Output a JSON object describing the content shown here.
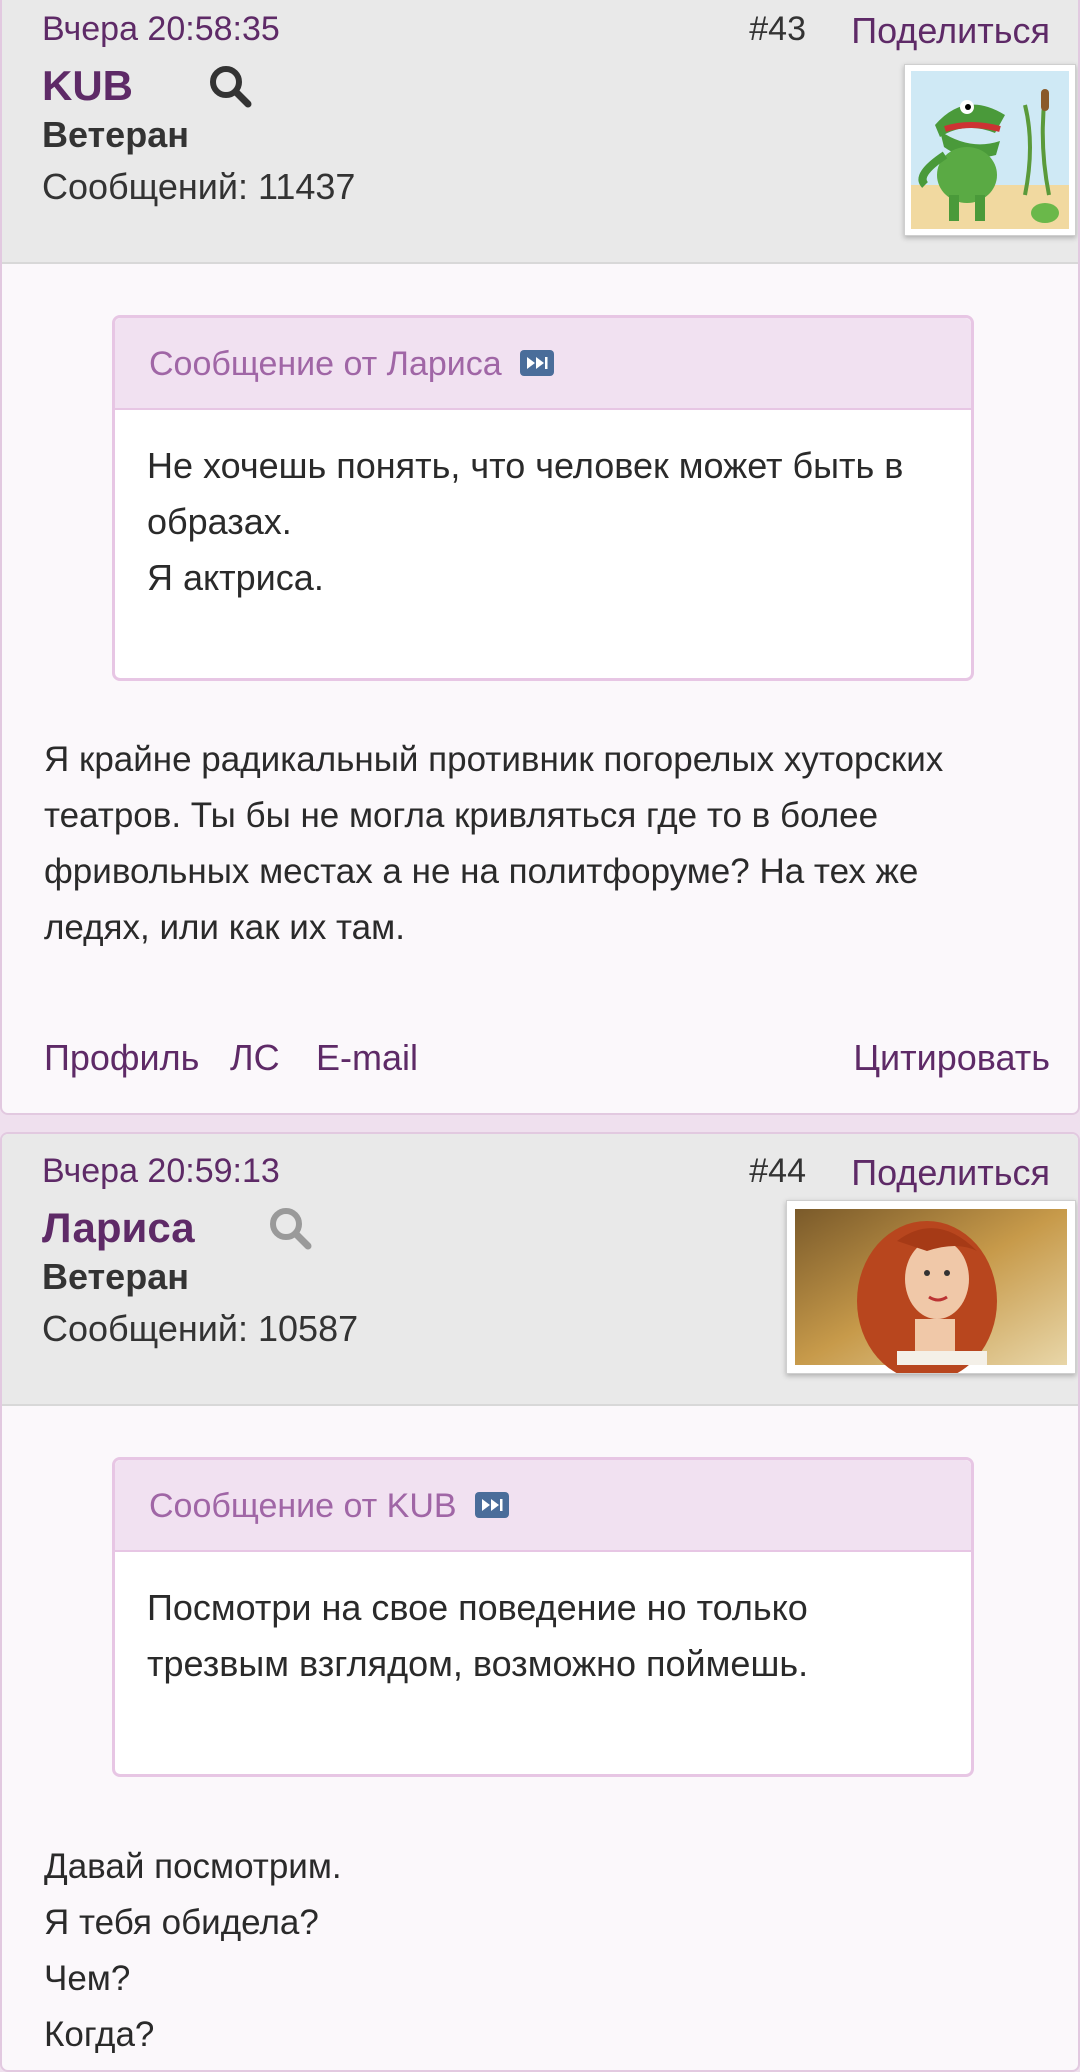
{
  "posts": [
    {
      "time": "Вчера 20:58:35",
      "number": "#43",
      "share_label": "Поделиться",
      "username": "KUB",
      "rank": "Ветеран",
      "messages_count": "Сообщений: 11437",
      "avatar_icon": "crocodile-cartoon-avatar",
      "quote": {
        "header": "Сообщение от Лариса",
        "lines": [
          "Не хочешь понять, что человек может быть в",
          "образах.",
          "Я актриса."
        ]
      },
      "message_lines": [
        "Я крайне радикальный противник погорелых хуторских",
        "театров. Ты бы не могла кривляться где то в более",
        "фривольных местах а не на политфоруме? На тех же",
        "ледях, или как их там."
      ],
      "actions": {
        "profile": "Профиль",
        "pm": "ЛС",
        "email": "E-mail",
        "quote": "Цитировать"
      }
    },
    {
      "time": "Вчера 20:59:13",
      "number": "#44",
      "share_label": "Поделиться",
      "username": "Лариса",
      "rank": "Ветеран",
      "messages_count": "Сообщений: 10587",
      "avatar_icon": "red-haired-woman-photo-avatar",
      "quote": {
        "header": "Сообщение от KUB",
        "lines": [
          "Посмотри на свое поведение но только",
          "трезвым взглядом, возможно поймешь."
        ]
      },
      "message_lines": [
        "Давай посмотрим.",
        "Я тебя обидела?",
        "Чем?",
        "Когда?"
      ]
    }
  ],
  "colors": {
    "accent": "#5e2a67",
    "quote_header": "#a066a6",
    "quote_border": "#e7c6e4",
    "header_bg": "#e9e9e9"
  }
}
